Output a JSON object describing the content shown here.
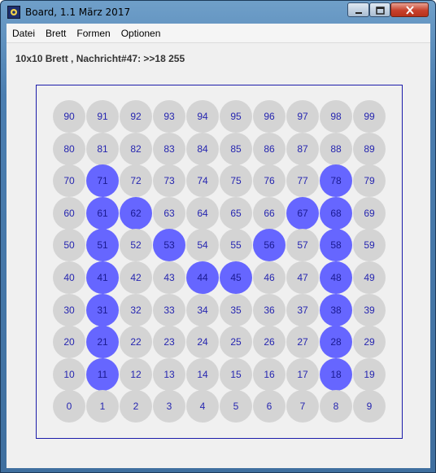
{
  "window": {
    "title": "Board, 1.1 März 2017"
  },
  "menu": {
    "items": [
      "Datei",
      "Brett",
      "Formen",
      "Optionen"
    ]
  },
  "status": "10x10 Brett , Nachricht#47: >>18 255",
  "board": {
    "size": 10,
    "colors": {
      "off": "#d4d4d4",
      "on": "#6666ff",
      "label": "#2626b0",
      "frame": "#1c1caa"
    },
    "active": [
      11,
      18,
      21,
      28,
      31,
      38,
      41,
      44,
      45,
      48,
      51,
      53,
      56,
      58,
      61,
      62,
      67,
      68,
      71,
      78
    ]
  }
}
